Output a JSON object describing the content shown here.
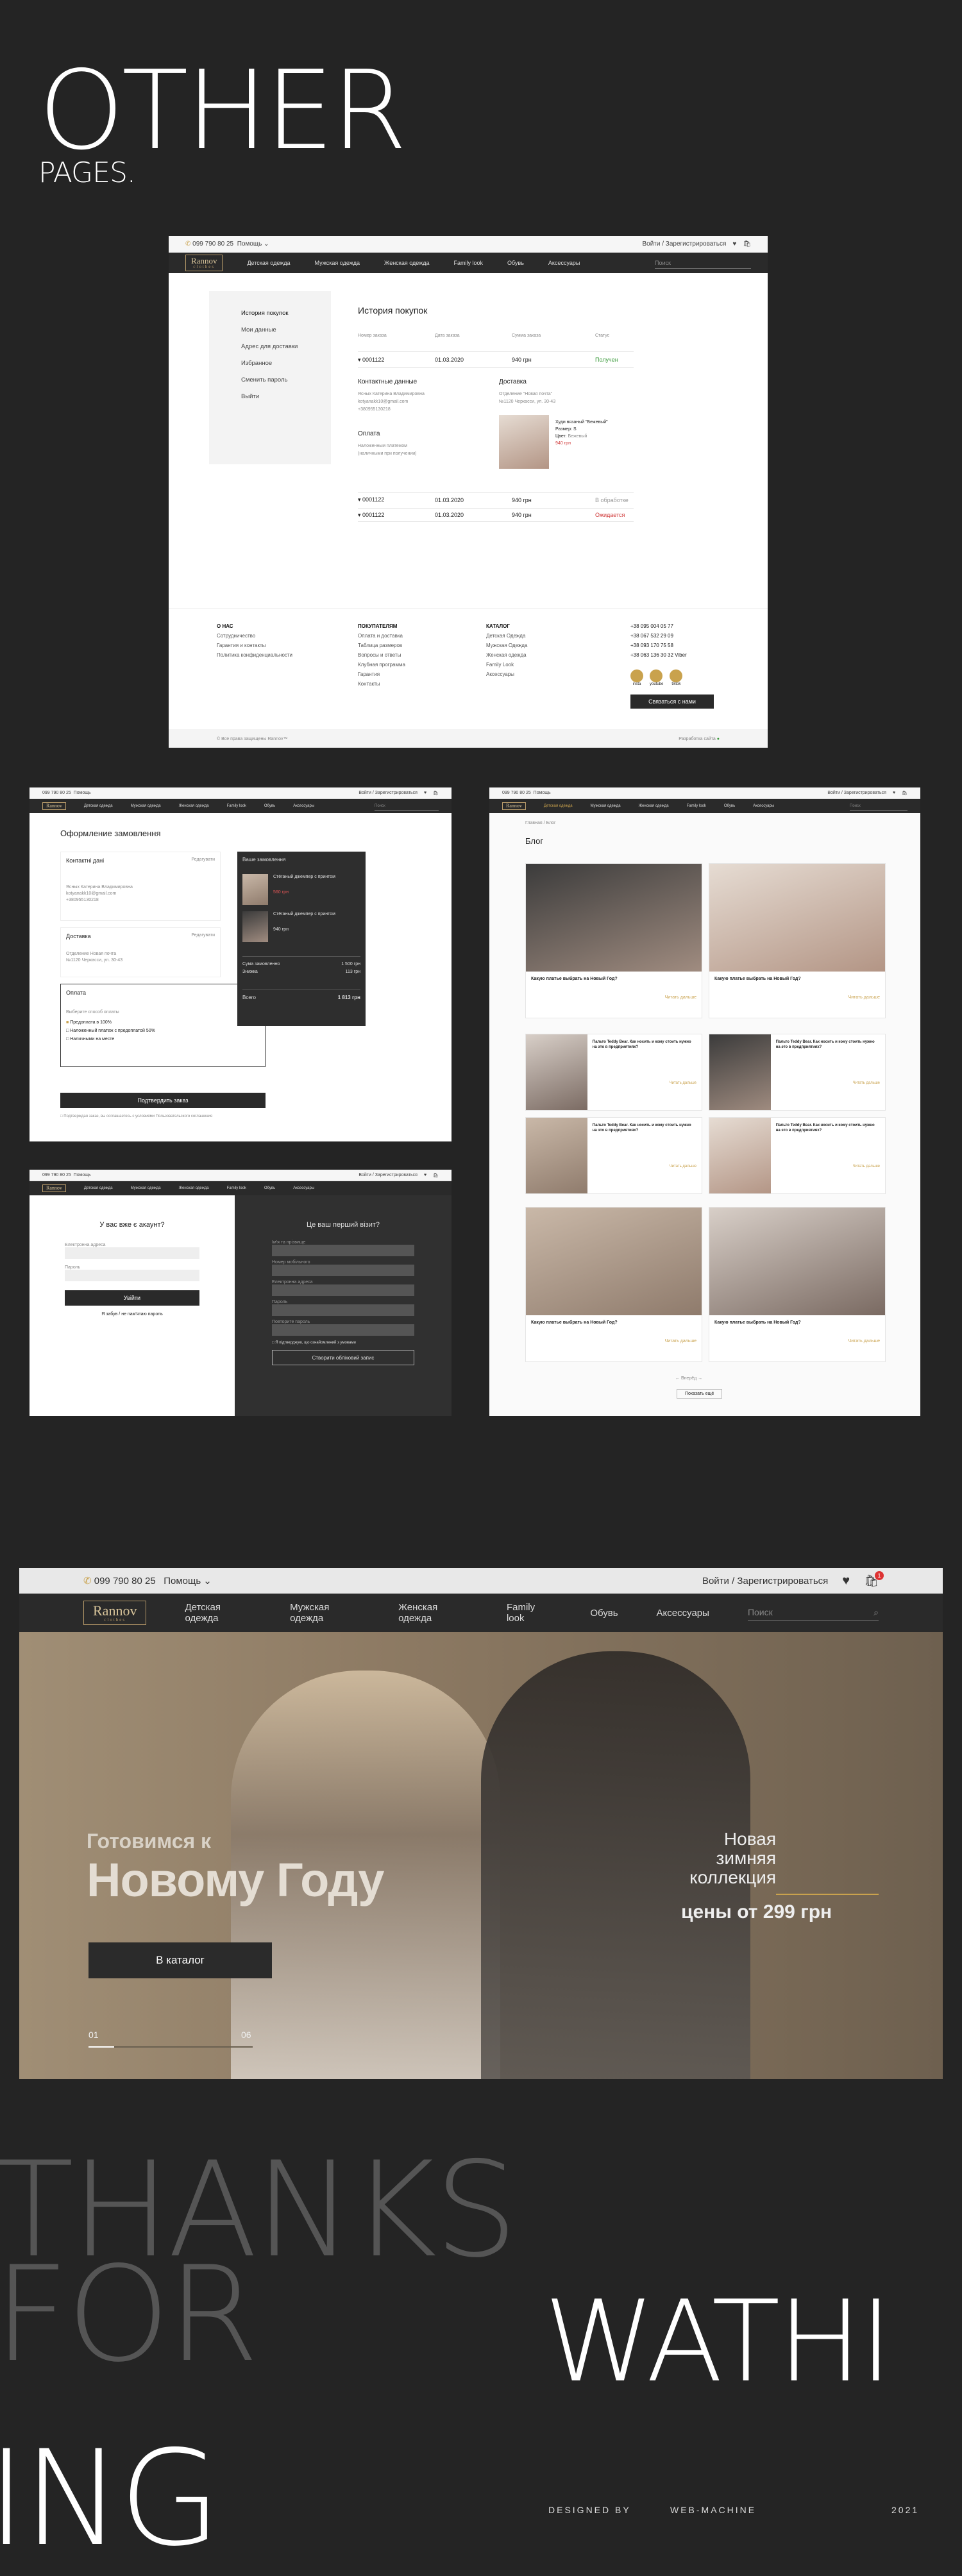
{
  "hero_title": {
    "line1": "OTHER",
    "line2": "PAGES."
  },
  "header": {
    "phone": "099 790 80 25",
    "help": "Помощь",
    "login": "Войти / Зарегистрироваться",
    "search_placeholder": "Поиск",
    "logo_name": "Rannov",
    "logo_sub": "clothes",
    "nav": [
      "Детская одежда",
      "Мужская одежда",
      "Женская одежда",
      "Family look",
      "Обувь",
      "Аксессуары"
    ]
  },
  "account": {
    "sidebar": [
      "История покупок",
      "Мои данные",
      "Адрес для доставки",
      "Избранное",
      "Сменить пароль",
      "Выйти"
    ],
    "title": "История покупок",
    "columns": [
      "Номер заказа",
      "Дата заказа",
      "Сумма заказа",
      "Статус"
    ],
    "orders": [
      {
        "num": "0001122",
        "date": "01.03.2020",
        "sum": "940 грн",
        "status": "Получен",
        "color": "#3a9a3a"
      },
      {
        "num": "0001122",
        "date": "01.03.2020",
        "sum": "940 грн",
        "status": "В обработке",
        "color": "#9a9a9a"
      },
      {
        "num": "0001122",
        "date": "01.03.2020",
        "sum": "940 грн",
        "status": "Ожидается",
        "color": "#d03a3a"
      }
    ],
    "contact_title": "Контактные данные",
    "contact_lines": [
      "Ясных Катерина Владимировна",
      "kotyanakk10@gmail.com",
      "+380955130218"
    ],
    "delivery_title": "Доставка",
    "delivery_lines": [
      "Отделение \"Новая почта\"",
      "№1120 Черкасси, ул. 30-43"
    ],
    "payment_title": "Оплата",
    "payment_lines": [
      "Наложенным платежом",
      "(наличными при получении)"
    ],
    "item_name": "Худи вязаный \"Бежевый\"",
    "item_size_label": "Размер:",
    "item_size": "S",
    "item_color_label": "Цвет:",
    "item_color": "Бежевый",
    "item_price": "940 грн"
  },
  "footer": {
    "col1_title": "О НАС",
    "col1": [
      "Сотрудничество",
      "Гарантия и контакты",
      "Политика конфиденциальности"
    ],
    "col2_title": "ПОКУПАТЕЛЯМ",
    "col2": [
      "Оплата и доставка",
      "Таблица размеров",
      "Вопросы и ответы",
      "Клубная программа",
      "Гарантия",
      "Контакты"
    ],
    "col3_title": "КАТАЛОГ",
    "col3": [
      "Детская Одежда",
      "Мужская Одежда",
      "Женская одежда",
      "Family Look",
      "Аксессуары"
    ],
    "phones": [
      "+38 095 004 05 77",
      "+38 067 532 29 09",
      "+38 093 170 75 58",
      "+38 063 136 30 32 Viber"
    ],
    "socials": [
      "insta",
      "youtube",
      "tiktok"
    ],
    "contact_btn": "Связаться с нами",
    "copyright": "© Все права защищены Rannov™",
    "dev": "Разработка сайта"
  },
  "checkout": {
    "title": "Оформление замовлення",
    "contact": "Контактні дані",
    "edit": "Редагувати",
    "contact_lines": [
      "Ясных Катерина Владимировна",
      "kotyanakk10@gmail.com",
      "+380955130218"
    ],
    "delivery": "Доставка",
    "delivery_lines": [
      "Отделение Новая почта",
      "№1120 Черкасси, ул. 30-43"
    ],
    "payment": "Оплата",
    "payment_hint": "Выберите способ оплаты",
    "payment_opts": [
      "Предоплата в 100%",
      "Наложенный платеж с предоплатой 50%",
      "Наличными на месте"
    ],
    "confirm_btn": "Подтвердить заказ",
    "agree": "Подтверждая заказ, вы соглашаетесь с условиями Пользовательского соглашения",
    "summary_title": "Ваше замовлення",
    "items": [
      {
        "name": "Стёганый джемпер с принтом",
        "price": "560 грн"
      },
      {
        "name": "Стёганый джемпер с принтом",
        "price": "940 грн"
      }
    ],
    "totals": [
      [
        "Сума замовлення",
        "1 500 грн"
      ],
      [
        "Знижка",
        "113 грн"
      ]
    ],
    "total_label": "Всего",
    "total_value": "1 813 грн"
  },
  "login": {
    "left_title": "У вас вже є акаунт?",
    "fields": [
      "Електронна адреса",
      "Пароль"
    ],
    "login_btn": "Увійти",
    "forgot": "Я забув / не пам'ятаю пароль",
    "right_title": "Це ваш перший візит?",
    "reg_fields": [
      "Ім'я та прізвище",
      "Номер мобільного",
      "Електронна адреса",
      "Пароль",
      "Повторите пароль"
    ],
    "agree": "Я підтверджую, що ознайомлений з умовами",
    "create_btn": "Створити обліковий запис"
  },
  "blog": {
    "crumbs": "Главная / Блог",
    "title": "Блог",
    "posts": [
      "Какую платье выбрать на Новый Год?",
      "Какую платье выбрать на Новый Год?",
      "Пальто Teddy Bear. Как носить и кому стоить нужно на это в предприятиях?",
      "Пальто Teddy Bear. Как носить и кому стоить нужно на это в предприятиях?",
      "Пальто Teddy Bear. Как носить и кому стоить нужно на это в предприятиях?",
      "Пальто Teddy Bear. Как носить и кому стоить нужно на это в предприятиях?",
      "Какую платье выбрать на Новый Год?",
      "Какую платье выбрать на Новый Год?"
    ],
    "more": "Читать дальше",
    "pager": "Вперёд",
    "load_more": "Показать ещё"
  },
  "promo": {
    "line1": "Готовимся к",
    "line2": "Новому Году",
    "catalog_btn": "В каталог",
    "right1": "Новая",
    "right2": "зимняя",
    "right3": "коллекция",
    "price": "цены от 299 грн",
    "slide_from": "01",
    "slide_to": "06",
    "cart_count": "1"
  },
  "outro": {
    "thanks": "THANKS",
    "for": "FOR",
    "wathi": "WATHI",
    "ing": "ING",
    "designed": "DESIGNED BY",
    "studio": "WEB-MACHINE",
    "year": "2021"
  }
}
